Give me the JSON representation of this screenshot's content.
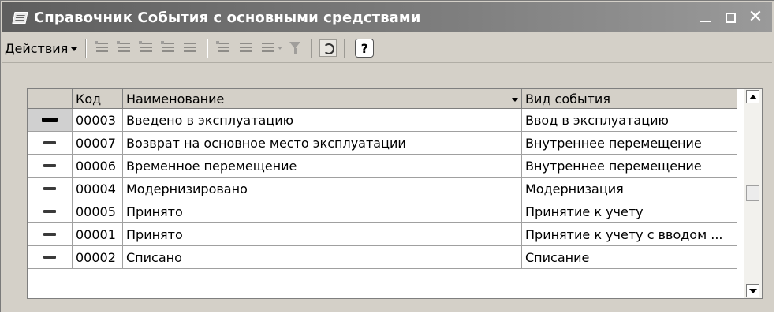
{
  "window": {
    "title": "Справочник События с основными средствами",
    "buttons": {
      "minimize": "_",
      "maximize": "□",
      "close": "✕"
    }
  },
  "toolbar": {
    "actions_label": "Действия",
    "help_label": "?",
    "icons": [
      "add-icon",
      "add-group-icon",
      "copy-icon",
      "edit-icon",
      "mark-delete-icon",
      "hierarchy-icon",
      "set-filter-icon",
      "filter-list-icon",
      "clear-filter-icon",
      "refresh-icon",
      "help-icon"
    ]
  },
  "table": {
    "columns": [
      "Код",
      "Наименование",
      "Вид события"
    ],
    "rows": [
      {
        "code": "00003",
        "name": "Введено в эксплуатацию",
        "type": "Ввод в эксплуатацию"
      },
      {
        "code": "00007",
        "name": "Возврат на основное место эксплуатации",
        "type": "Внутреннее перемещение"
      },
      {
        "code": "00006",
        "name": "Временное перемещение",
        "type": "Внутреннее перемещение"
      },
      {
        "code": "00004",
        "name": "Модернизировано",
        "type": "Модернизация"
      },
      {
        "code": "00005",
        "name": "Принято",
        "type": "Принятие к учету"
      },
      {
        "code": "00001",
        "name": "Принято",
        "type": "Принятие к учету с вводом ..."
      },
      {
        "code": "00002",
        "name": "Списано",
        "type": "Списание"
      }
    ],
    "selected_row": 0
  }
}
